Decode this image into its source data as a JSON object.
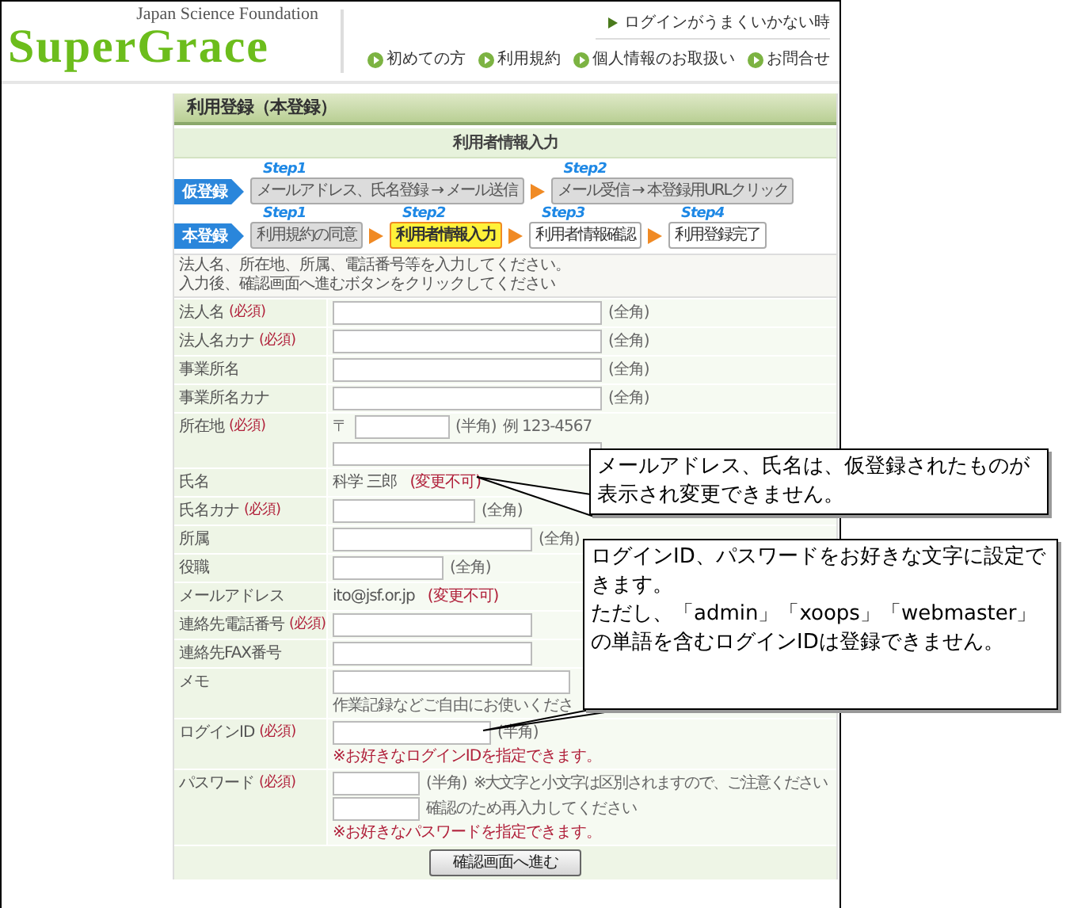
{
  "header": {
    "tagline": "Japan Science Foundation",
    "logo": "SuperGrace",
    "help_link": "ログインがうまくいかない時",
    "nav": [
      "初めての方",
      "利用規約",
      "個人情報のお取扱い",
      "お問合せ"
    ]
  },
  "panel": {
    "title": "利用登録（本登録）",
    "subtitle": "利用者情報入力",
    "stages": [
      {
        "label": "仮登録",
        "steps": [
          {
            "step": "Step1",
            "label": "メールアドレス、氏名登録 → メール送信",
            "completed": true,
            "selected": false
          },
          {
            "step": "Step2",
            "label": "メール受信 → 本登録用URLクリック",
            "completed": true,
            "selected": false
          }
        ]
      },
      {
        "label": "本登録",
        "steps": [
          {
            "step": "Step1",
            "label": "利用規約の同意",
            "completed": true,
            "selected": false
          },
          {
            "step": "Step2",
            "label": "利用者情報入力",
            "completed": false,
            "selected": true
          },
          {
            "step": "Step3",
            "label": "利用者情報確認",
            "completed": false,
            "selected": false
          },
          {
            "step": "Step4",
            "label": "利用登録完了",
            "completed": false,
            "selected": false
          }
        ]
      }
    ],
    "instructions": [
      "法人名、所在地、所属、電話番号等を入力してください。",
      "入力後、確認画面へ進むボタンをクリックしてください"
    ],
    "rows": [
      {
        "label": "法人名",
        "required": "(必須)",
        "kind": "long",
        "note": "(全角)"
      },
      {
        "label": "法人名カナ",
        "required": "(必須)",
        "kind": "long",
        "note": "(全角)"
      },
      {
        "label": "事業所名",
        "kind": "long",
        "note": "(全角)"
      },
      {
        "label": "事業所名カナ",
        "kind": "long",
        "note": "(全角)"
      },
      {
        "label": "所在地",
        "required": "(必須)",
        "kind": "postal",
        "prefix": "〒",
        "note": "(半角)",
        "example": "例 123-4567"
      },
      {
        "label": "氏名",
        "kind": "display",
        "value": "科学 三郎",
        "note": "(変更不可)"
      },
      {
        "label": "氏名カナ",
        "required": "(必須)",
        "kind": "medium",
        "note": "(全角)"
      },
      {
        "label": "所属",
        "kind": "wide",
        "note": "(全角)"
      },
      {
        "label": "役職",
        "kind": "short",
        "note": "(全角)"
      },
      {
        "label": "メールアドレス",
        "kind": "display",
        "value": "ito@jsf.or.jp",
        "note": "(変更不可)"
      },
      {
        "label": "連絡先電話番号",
        "required": "(必須)",
        "kind": "wide"
      },
      {
        "label": "連絡先FAX番号",
        "kind": "wide"
      },
      {
        "label": "メモ",
        "kind": "memo",
        "hint": "作業記録などご自由にお使いくださ"
      },
      {
        "label": "ログインID",
        "required": "(必須)",
        "kind": "login",
        "note": "(半角)",
        "hint": "※お好きなログインIDを指定できます。"
      },
      {
        "label": "パスワード",
        "required": "(必須)",
        "kind": "password",
        "note": "(半角)",
        "caution": "※大文字と小文字は区別されますので、ご注意ください",
        "confirm": "確認のため再入力してください",
        "hint": "※お好きなパスワードを指定できます。"
      }
    ],
    "submit": "確認画面へ進む"
  },
  "callouts": [
    {
      "lines": [
        "メールアドレス、氏名は、仮登録されたものが表示され変更できません。"
      ]
    },
    {
      "lines": [
        "ログインID、パスワードをお好きな文字に設定できます。",
        "ただし、「admin」「xoops」「webmaster」の単語を含むログインIDは登録できません。"
      ]
    }
  ]
}
